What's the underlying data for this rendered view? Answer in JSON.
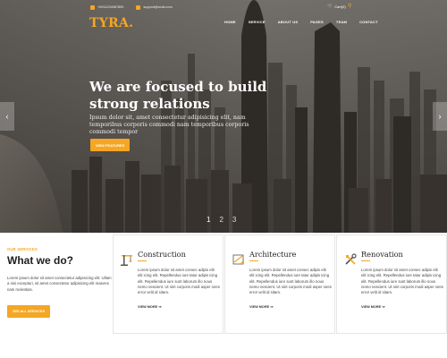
{
  "topbar": {
    "phone": "+0011234567890",
    "email": "support@wolk.com",
    "cart": "Cart(0)"
  },
  "brand": {
    "logo": "TYRA."
  },
  "nav": {
    "items": [
      "HOME",
      "SERVICE",
      "ABOUT US",
      "PAGES",
      "TEAM",
      "CONTACT"
    ]
  },
  "hero": {
    "headline": "We are focused to build strong relations",
    "subtext": "Ipsum dolor sit, amet consectetur adipisicing elit, nam temporibus corporis commodi nam temporibus corporis commodi tempor",
    "button": "VIEW FEATURES",
    "prev_arrow": "‹",
    "next_arrow": "›",
    "pages": [
      "1",
      "2",
      "3"
    ],
    "active_page": 1
  },
  "services": {
    "eyebrow": "OUR SERVICES",
    "title": "What we do?",
    "description": "Lorem ipsum dolor sit amet consectetur adipisicing elit. Ullam a nisi excepturi, sit amet consectetur adipisicing elit maiores nam molestias.",
    "button": "SEE ALL SERVICES",
    "cards": [
      {
        "title": "Construction",
        "icon": "crane-icon",
        "body": "Lorem ipsum dolor sit amet consec adipis elit elit icing elit. Repellendus iure tatur adipis icing elit. Repellendus iure sunt laborum illo nous nemo nescient. Ut sint corporis modi asper iores error velit id sitam.",
        "more": "VIEW MORE ⇒"
      },
      {
        "title": "Architecture",
        "icon": "blueprint-icon",
        "body": "Lorem ipsum dolor sit amet consec adipis elit elit icing elit. Repellendus iure tatur adipis icing elit. Repellendus iure sunt laborum illo nous nemo nescient. Ut sint corporis modi asper iores error velit id sitam.",
        "more": "VIEW MORE ⇒"
      },
      {
        "title": "Renovation",
        "icon": "tools-icon",
        "body": "Lorem ipsum dolor sit amet consec adipis elit elit icing elit. Repellendus iure tatur adipis icing elit. Repellendus iure sunt laborum illo nous nemo nescient. Ut sint corporis modi asper iores error velit id sitam.",
        "more": "VIEW MORE ⇒"
      }
    ]
  },
  "colors": {
    "accent": "#f5a623",
    "heading": "#1e1e1e",
    "body_text": "#444444"
  }
}
